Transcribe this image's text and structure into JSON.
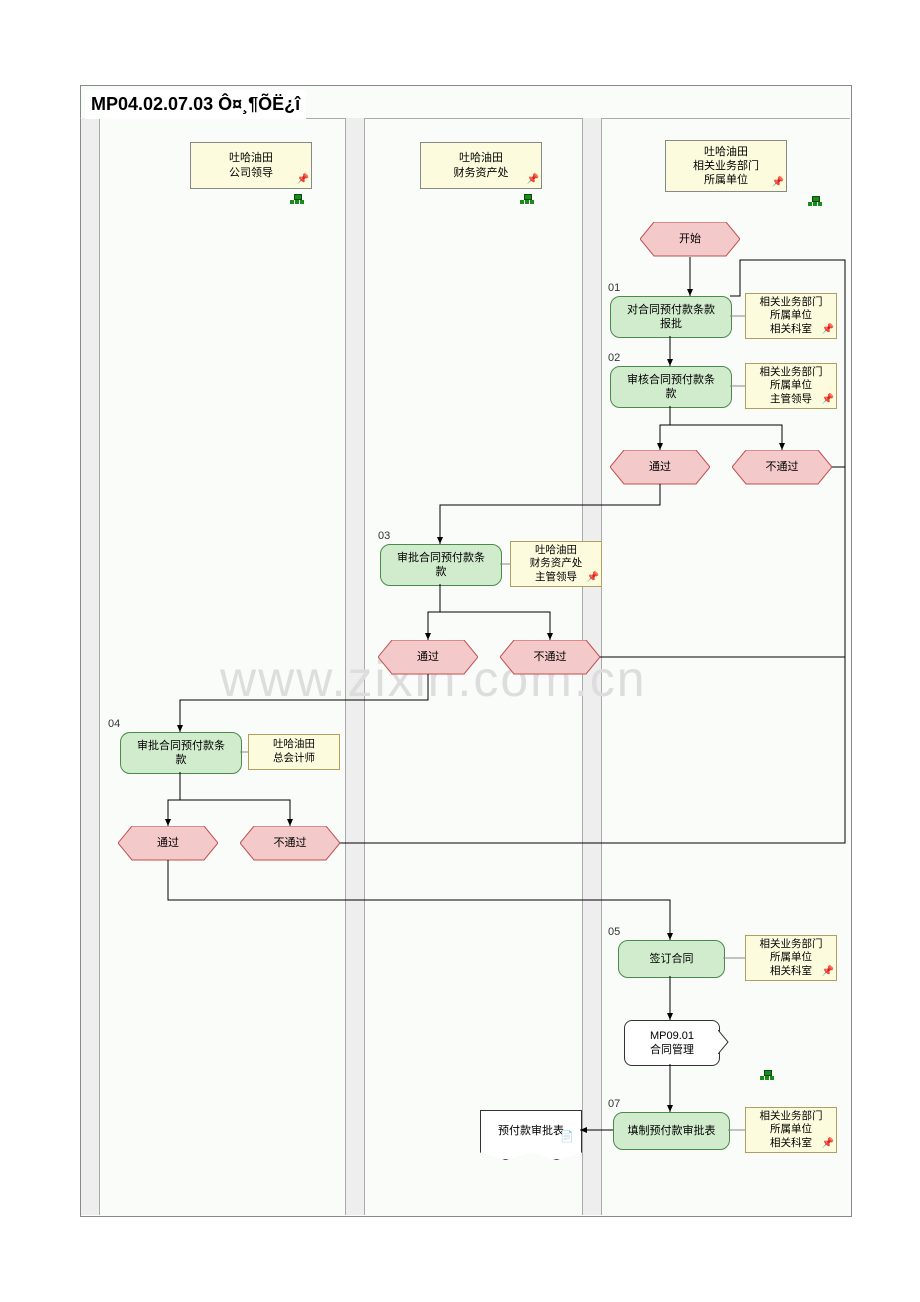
{
  "title": "MP04.02.07.03 Ô¤¸¶ÕË¿î",
  "lanes": {
    "col1": "吐哈油田\n公司领导",
    "col2": "吐哈油田\n财务资产处",
    "col3": "吐哈油田\n相关业务部门\n所属单位"
  },
  "steps": {
    "s01": "01",
    "s02": "02",
    "s03": "03",
    "s04": "04",
    "s05": "05",
    "s07": "07"
  },
  "nodes": {
    "start": "开始",
    "p01": "对合同预付款条款\n报批",
    "n01": "相关业务部门\n所属单位\n相关科室",
    "p02": "审核合同预付款条\n款",
    "n02": "相关业务部门\n所属单位\n主管领导",
    "d02_pass": "通过",
    "d02_fail": "不通过",
    "p03": "审批合同预付款条\n款",
    "n03": "吐哈油田\n财务资产处\n主管领导",
    "d03_pass": "通过",
    "d03_fail": "不通过",
    "p04": "审批合同预付款条\n款",
    "n04": "吐哈油田\n总会计师",
    "d04_pass": "通过",
    "d04_fail": "不通过",
    "p05": "签订合同",
    "n05": "相关业务部门\n所属单位\n相关科室",
    "sub06": "MP09.01\n合同管理",
    "p07": "填制预付款审批表",
    "n07": "相关业务部门\n所属单位\n相关科室",
    "doc07": "预付款审批表"
  },
  "watermark": "www.zixin.com.cn",
  "chart_data": {
    "type": "flowchart",
    "title": "MP04.02.07.03 预付账款",
    "swimlanes": [
      {
        "id": "L1",
        "label": "吐哈油田 公司领导"
      },
      {
        "id": "L2",
        "label": "吐哈油田 财务资产处"
      },
      {
        "id": "L3",
        "label": "吐哈油田 相关业务部门 所属单位"
      }
    ],
    "nodes": [
      {
        "id": "start",
        "lane": "L3",
        "type": "terminator",
        "label": "开始"
      },
      {
        "id": "01",
        "lane": "L3",
        "type": "process",
        "label": "对合同预付款条款报批",
        "actor": "相关业务部门 所属单位 相关科室"
      },
      {
        "id": "02",
        "lane": "L3",
        "type": "process",
        "label": "审核合同预付款条款",
        "actor": "相关业务部门 所属单位 主管领导"
      },
      {
        "id": "02d",
        "lane": "L3",
        "type": "decision",
        "labels": [
          "通过",
          "不通过"
        ]
      },
      {
        "id": "03",
        "lane": "L2",
        "type": "process",
        "label": "审批合同预付款条款",
        "actor": "吐哈油田 财务资产处 主管领导"
      },
      {
        "id": "03d",
        "lane": "L2",
        "type": "decision",
        "labels": [
          "通过",
          "不通过"
        ]
      },
      {
        "id": "04",
        "lane": "L1",
        "type": "process",
        "label": "审批合同预付款条款",
        "actor": "吐哈油田 总会计师"
      },
      {
        "id": "04d",
        "lane": "L1",
        "type": "decision",
        "labels": [
          "通过",
          "不通过"
        ]
      },
      {
        "id": "05",
        "lane": "L3",
        "type": "process",
        "label": "签订合同",
        "actor": "相关业务部门 所属单位 相关科室"
      },
      {
        "id": "06",
        "lane": "L3",
        "type": "subprocess",
        "label": "MP09.01 合同管理"
      },
      {
        "id": "07",
        "lane": "L3",
        "type": "process",
        "label": "填制预付款审批表",
        "actor": "相关业务部门 所属单位 相关科室"
      },
      {
        "id": "doc07",
        "lane": "L3",
        "type": "document",
        "label": "预付款审批表"
      }
    ],
    "edges": [
      {
        "from": "start",
        "to": "01"
      },
      {
        "from": "01",
        "to": "02"
      },
      {
        "from": "02",
        "to": "02d"
      },
      {
        "from": "02d",
        "to": "03",
        "label": "通过"
      },
      {
        "from": "02d",
        "to": "01",
        "label": "不通过"
      },
      {
        "from": "03",
        "to": "03d"
      },
      {
        "from": "03d",
        "to": "04",
        "label": "通过"
      },
      {
        "from": "03d",
        "to": "01",
        "label": "不通过"
      },
      {
        "from": "04",
        "to": "04d"
      },
      {
        "from": "04d",
        "to": "05",
        "label": "通过"
      },
      {
        "from": "04d",
        "to": "01",
        "label": "不通过"
      },
      {
        "from": "05",
        "to": "06"
      },
      {
        "from": "06",
        "to": "07"
      },
      {
        "from": "07",
        "to": "doc07"
      }
    ]
  }
}
